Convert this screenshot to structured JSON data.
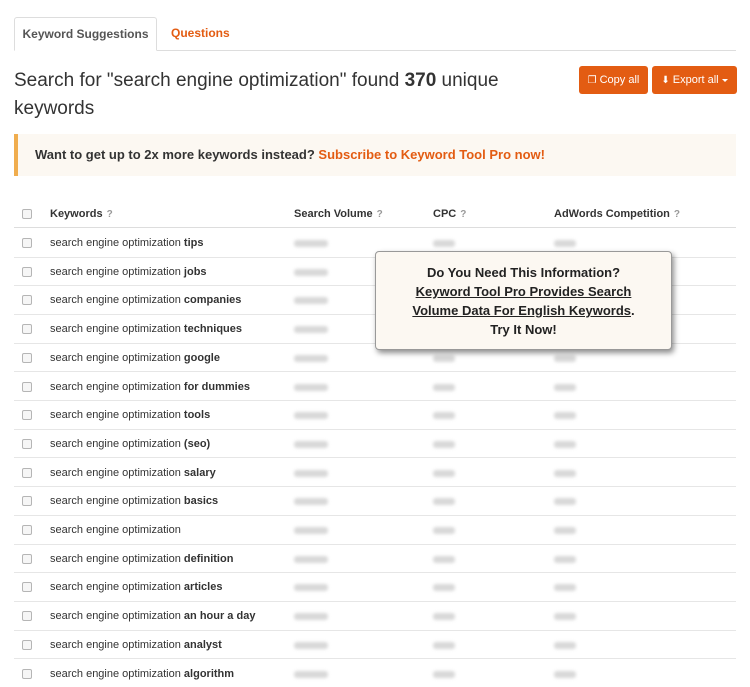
{
  "tabs": [
    {
      "label": "Keyword Suggestions",
      "active": true
    },
    {
      "label": "Questions",
      "active": false
    }
  ],
  "headline": {
    "prefix": "Search for \"search engine optimization\" found",
    "count": "370",
    "suffix": "unique keywords"
  },
  "buttons": {
    "copy_all": "Copy all",
    "export_all": "Export all"
  },
  "promo": {
    "text": "Want to get up to 2x more keywords instead?",
    "link": "Subscribe to Keyword Tool Pro now!"
  },
  "table": {
    "columns": [
      {
        "label": "Keywords",
        "help": "?"
      },
      {
        "label": "Search Volume",
        "help": "?"
      },
      {
        "label": "CPC",
        "help": "?"
      },
      {
        "label": "AdWords Competition",
        "help": "?"
      }
    ],
    "rows": [
      {
        "base": "search engine optimization",
        "suffix": "tips"
      },
      {
        "base": "search engine optimization",
        "suffix": "jobs"
      },
      {
        "base": "search engine optimization",
        "suffix": "companies"
      },
      {
        "base": "search engine optimization",
        "suffix": "techniques"
      },
      {
        "base": "search engine optimization",
        "suffix": "google"
      },
      {
        "base": "search engine optimization",
        "suffix": "for dummies"
      },
      {
        "base": "search engine optimization",
        "suffix": "tools"
      },
      {
        "base": "search engine optimization",
        "suffix": "(seo)"
      },
      {
        "base": "search engine optimization",
        "suffix": "salary"
      },
      {
        "base": "search engine optimization",
        "suffix": "basics"
      },
      {
        "base": "search engine optimization",
        "suffix": ""
      },
      {
        "base": "search engine optimization",
        "suffix": "definition"
      },
      {
        "base": "search engine optimization",
        "suffix": "articles"
      },
      {
        "base": "search engine optimization",
        "suffix": "an hour a day"
      },
      {
        "base": "search engine optimization",
        "suffix": "analyst"
      },
      {
        "base": "search engine optimization",
        "suffix": "algorithm"
      }
    ]
  },
  "popup": {
    "line1": "Do You Need This Information?",
    "line2": "Keyword Tool Pro Provides Search",
    "line3": "Volume Data For English Keywords",
    "line3_end": ".",
    "line4": "Try It Now!"
  },
  "colors": {
    "accent": "#e35c12",
    "promo_border": "#f0ad4e",
    "promo_bg": "#fcf8f2"
  }
}
